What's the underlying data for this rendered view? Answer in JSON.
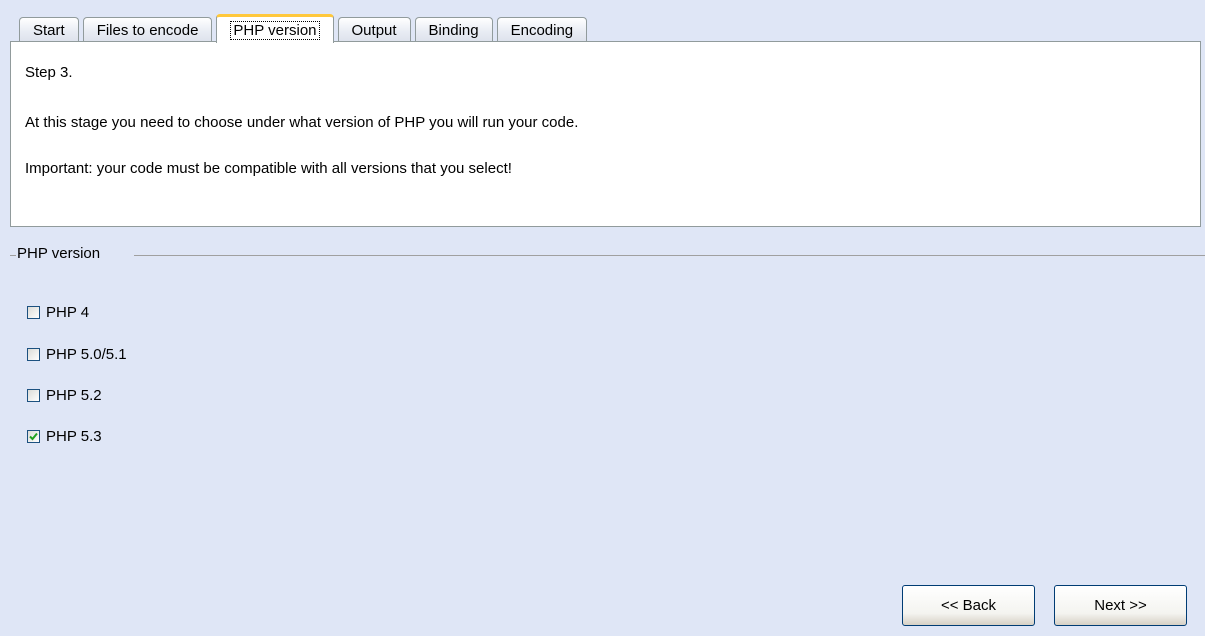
{
  "tabs": [
    {
      "label": "Start"
    },
    {
      "label": "Files to encode"
    },
    {
      "label": "PHP version",
      "active": true
    },
    {
      "label": "Output"
    },
    {
      "label": "Binding"
    },
    {
      "label": "Encoding"
    }
  ],
  "info": {
    "step": "Step 3.",
    "line1": "At this stage you need to choose under what version of PHP you will run your code.",
    "line2": "Important: your code must be compatible with all versions that you select!"
  },
  "php_version_group": {
    "title": "PHP version",
    "options": [
      {
        "label": "PHP 4",
        "checked": false
      },
      {
        "label": "PHP 5.0/5.1",
        "checked": false
      },
      {
        "label": "PHP 5.2",
        "checked": false
      },
      {
        "label": "PHP 5.3",
        "checked": true
      }
    ]
  },
  "buttons": {
    "back_label": "<< Back",
    "next_label": "Next >>"
  },
  "icons": {
    "checkmark": "checkmark-icon"
  },
  "colors": {
    "background": "#dfe6f6",
    "active_tab_accent": "#ffc83c",
    "checkbox_border": "#1c5180",
    "checkmark": "#21a121"
  }
}
